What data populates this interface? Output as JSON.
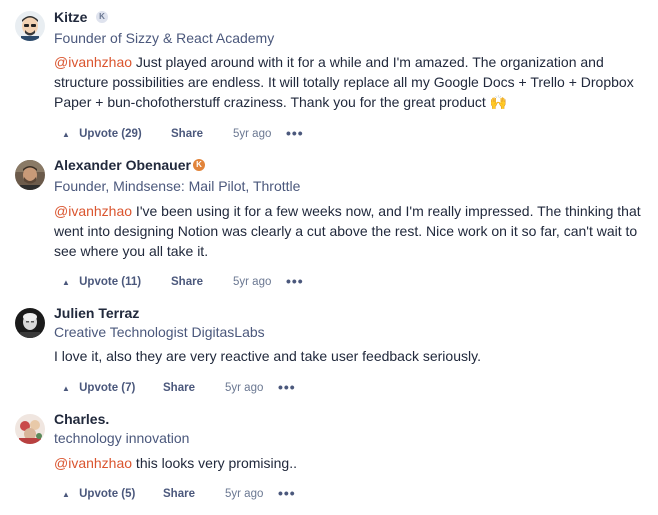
{
  "comments": [
    {
      "name": "Kitze",
      "badge": "K",
      "headline": "Founder of Sizzy & React Academy",
      "mention": "@ivanhzhao",
      "text": " Just played around with it for a while and I'm amazed. The organization and structure possibilities are endless. It will totally replace all my Google Docs + Trello + Dropbox Paper + bun-chofotherstuff craziness. Thank you for the great product 🙌",
      "upvote_label": "Upvote (29)",
      "share_label": "Share",
      "time": "5yr ago",
      "more": "•••"
    },
    {
      "name": "Alexander Obenauer",
      "badge": "K",
      "headline": "Founder, Mindsense: Mail Pilot, Throttle",
      "mention": "@ivanhzhao",
      "text": " I've been using it for a few weeks now, and I'm really impressed. The thinking that went into designing Notion was clearly a cut above the rest. Nice work on it so far, can't wait to see where you all take it.",
      "upvote_label": "Upvote (11)",
      "share_label": "Share",
      "time": "5yr ago",
      "more": "•••"
    },
    {
      "name": "Julien Terraz",
      "headline": "Creative Technologist DigitasLabs",
      "text": "I love it, also they are very reactive and take user feedback seriously.",
      "upvote_label": "Upvote (7)",
      "share_label": "Share",
      "time": "5yr ago",
      "more": "•••"
    },
    {
      "name": "Charles.",
      "headline": "technology innovation",
      "mention": "@ivanhzhao",
      "text": " this looks very promising..",
      "upvote_label": "Upvote (5)",
      "share_label": "Share",
      "time": "5yr ago",
      "more": "•••"
    }
  ],
  "upvote_icon": "upvote-arrow-icon",
  "colors": {
    "mention": "#da552f",
    "text": "#21293c",
    "muted": "#4b587c",
    "badge_orange": "#e2843a"
  }
}
